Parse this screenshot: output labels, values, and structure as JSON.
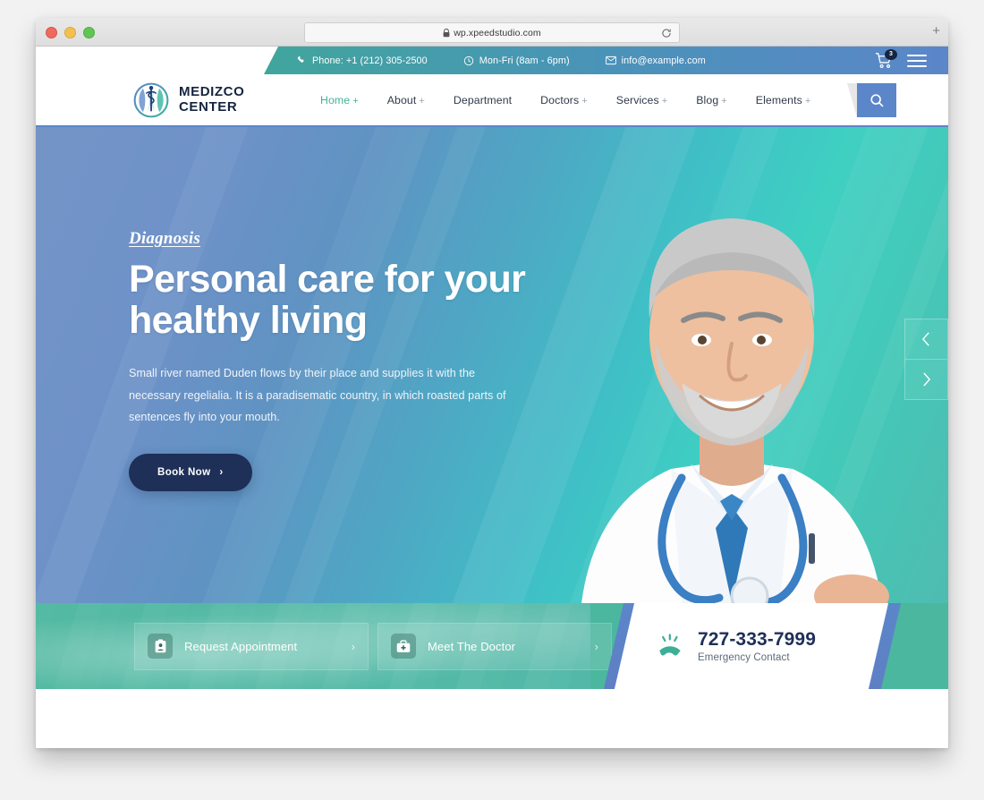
{
  "browser": {
    "url": "wp.xpeedstudio.com",
    "lock_icon": "lock-icon",
    "reload_icon": "reload-icon",
    "new_tab_label": "+",
    "traffic_lights": [
      "close",
      "minimize",
      "maximize"
    ]
  },
  "topbar": {
    "items": [
      {
        "icon": "phone-icon",
        "text": "Phone: +1 (212) 305-2500"
      },
      {
        "icon": "clock-icon",
        "text": "Mon-Fri (8am - 6pm)"
      },
      {
        "icon": "envelope-icon",
        "text": "info@example.com"
      }
    ],
    "cart": {
      "icon": "cart-icon",
      "badge": "3"
    },
    "menu_icon": "hamburger-icon"
  },
  "logo": {
    "icon": "medical-caduceus-icon",
    "line1": "MEDIZCO",
    "line2": "CENTER"
  },
  "nav": {
    "items": [
      {
        "label": "Home",
        "has_submenu": true,
        "active": true
      },
      {
        "label": "About",
        "has_submenu": true,
        "active": false
      },
      {
        "label": "Department",
        "has_submenu": false,
        "active": false
      },
      {
        "label": "Doctors",
        "has_submenu": true,
        "active": false
      },
      {
        "label": "Services",
        "has_submenu": true,
        "active": false
      },
      {
        "label": "Blog",
        "has_submenu": true,
        "active": false
      },
      {
        "label": "Elements",
        "has_submenu": true,
        "active": false
      }
    ],
    "submenu_marker": "+",
    "search_icon": "search-icon"
  },
  "hero": {
    "eyebrow": "Diagnosis",
    "headline_line1": "Personal care for your",
    "headline_line2": "healthy living",
    "paragraph": "Small river named Duden flows by their place and supplies it with the necessary regelialia. It is a paradisematic country, in which roasted parts of sentences fly into your mouth.",
    "cta_label": "Book Now",
    "cta_arrow": "›",
    "photo_alt": "smiling-doctor-white-coat-stethoscope",
    "prev_icon": "chevron-left-icon",
    "next_icon": "chevron-right-icon"
  },
  "cta_band": {
    "cards": [
      {
        "icon": "clipboard-icon",
        "label": "Request Appointment",
        "chevron": "›"
      },
      {
        "icon": "medical-bag-icon",
        "label": "Meet The Doctor",
        "chevron": "›"
      }
    ],
    "phone": {
      "icon": "ringing-phone-icon",
      "number": "727-333-7999",
      "caption": "Emergency Contact"
    }
  },
  "colors": {
    "teal": "#3fb39b",
    "blue": "#5b86c9",
    "navy": "#1e2f58",
    "band_green": "#4cb79f"
  }
}
